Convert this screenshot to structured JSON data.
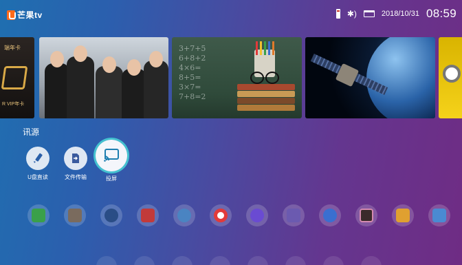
{
  "header": {
    "logo_text": "芒果tv",
    "date": "2018/10/31",
    "time": "08:59",
    "icons": [
      "usb-drive-icon",
      "bluetooth-icon",
      "storage-card-icon"
    ]
  },
  "banners": {
    "vip_card": {
      "top_text": "端年卡",
      "bottom_text": "R VIP年卡"
    },
    "chalkboard_lines": [
      "3+7+5",
      "6+8+2",
      "4×6=",
      "8+5=",
      "3×7=",
      "7+8=2"
    ]
  },
  "sources": {
    "title": "讯源",
    "items": [
      {
        "label": "U盘直读",
        "icon": "pencil-icon"
      },
      {
        "label": "文件传输",
        "icon": "file-transfer-icon"
      },
      {
        "label": "投屏",
        "icon": "screen-cast-icon"
      }
    ],
    "selected": "投屏"
  },
  "apps": {
    "icons": [
      "tv-icon",
      "clapperboard-icon",
      "camera-lens-icon",
      "puzzle-app-icon",
      "robot-app-icon",
      "opera-icon",
      "video-player-icon",
      "settings-app-icon",
      "browser-app-icon",
      "gallery-app-icon",
      "folder-app-icon",
      "camera-app-icon"
    ],
    "colors": [
      "#3aa04a",
      "#7a6b5e",
      "#2a4d86",
      "#c23a3a",
      "#4a84c2",
      "#e23a3a",
      "#6a4bd2",
      "#6b5ab0",
      "#3a6fd0",
      "#3a2a2a",
      "#e0a030",
      "#4a8ad2"
    ]
  }
}
